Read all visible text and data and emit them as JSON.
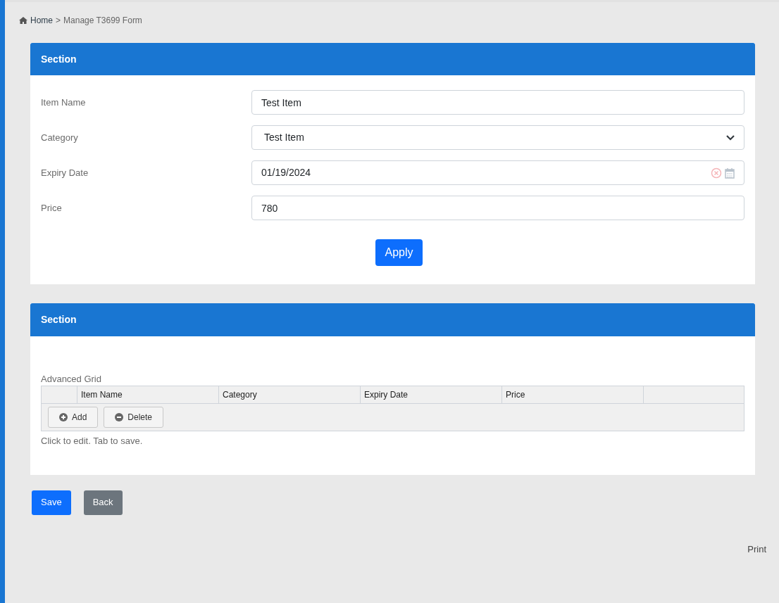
{
  "breadcrumb": {
    "home": "Home",
    "separator": ">",
    "current": "Manage T3699 Form"
  },
  "form_section": {
    "title": "Section",
    "fields": [
      {
        "kind": "text",
        "label": "Item Name",
        "value": "Test Item"
      },
      {
        "kind": "select",
        "label": "Category",
        "value": "Test Item"
      },
      {
        "kind": "date",
        "label": "Expiry Date",
        "value": "01/19/2024"
      },
      {
        "kind": "text",
        "label": "Price",
        "value": "780"
      }
    ],
    "apply_button": "Apply"
  },
  "grid_section": {
    "title": "Section",
    "grid_title": "Advanced Grid",
    "columns": [
      "Item Name",
      "Category",
      "Expiry Date",
      "Price"
    ],
    "toolbar": [
      {
        "kind": "add",
        "label": "Add"
      },
      {
        "kind": "delete",
        "label": "Delete"
      }
    ],
    "hint": "Click to edit. Tab to save."
  },
  "buttons": [
    {
      "kind": "primary",
      "label": "Save"
    },
    {
      "kind": "secondary",
      "label": "Back"
    }
  ],
  "print_link": "Print"
}
